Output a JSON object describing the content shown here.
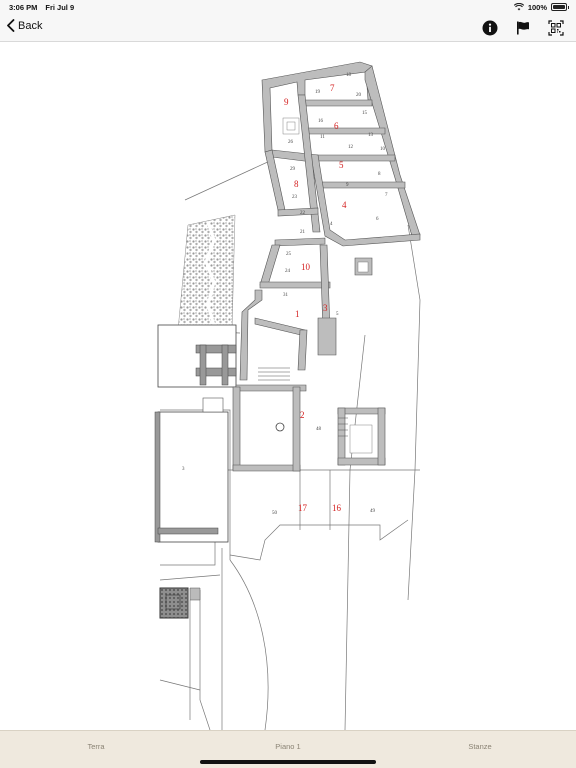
{
  "status_bar": {
    "time": "3:06 PM",
    "date": "Fri Jul 9",
    "battery": "100%"
  },
  "nav": {
    "back_label": "Back",
    "icons": [
      "info-icon",
      "flag-icon",
      "qr-code-icon"
    ]
  },
  "map": {
    "rooms": [
      "1",
      "2",
      "3",
      "4",
      "5",
      "6",
      "7",
      "8",
      "9",
      "10",
      "16",
      "17"
    ],
    "sub_labels": [
      "18",
      "19",
      "20",
      "11",
      "12",
      "13",
      "15",
      "16",
      "9",
      "10",
      "6",
      "7",
      "8",
      "21",
      "22",
      "23",
      "24",
      "25",
      "26",
      "29",
      "31",
      "4",
      "5",
      "48",
      "49",
      "50",
      "3"
    ]
  },
  "tabs": [
    {
      "label": "Terra"
    },
    {
      "label": "Piano 1"
    },
    {
      "label": "Stanze"
    }
  ],
  "colors": {
    "wall": "#bdbdbd",
    "line": "#555555",
    "room_number": "#d42020",
    "tab_bar": "#efe9de",
    "tab_text": "#8a8374"
  }
}
